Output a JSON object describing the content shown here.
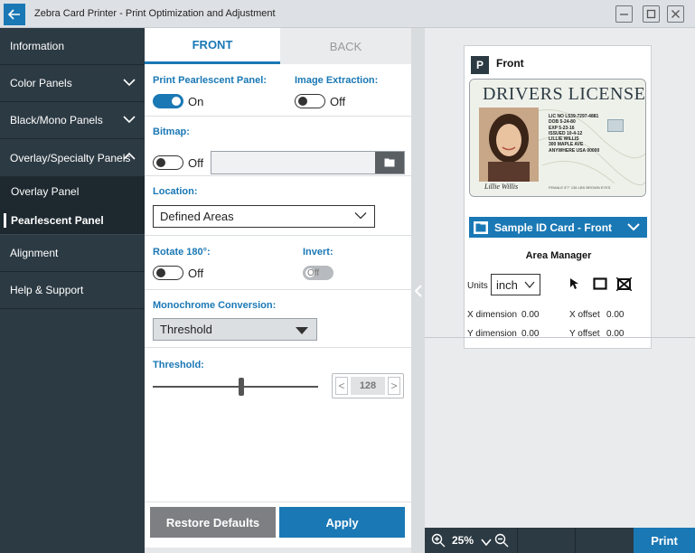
{
  "window": {
    "title": "Zebra Card Printer - Print Optimization and Adjustment"
  },
  "sidebar": {
    "items": [
      {
        "label": "Information"
      },
      {
        "label": "Color Panels"
      },
      {
        "label": "Black/Mono Panels"
      },
      {
        "label": "Overlay/Specialty Panels"
      },
      {
        "label": "Overlay Panel"
      },
      {
        "label": "Pearlescent Panel"
      },
      {
        "label": "Alignment"
      },
      {
        "label": "Help & Support"
      }
    ]
  },
  "tabs": {
    "front": "FRONT",
    "back": "BACK"
  },
  "settings": {
    "print_pearlescent": {
      "label": "Print Pearlescent Panel:",
      "state": "On"
    },
    "image_extraction": {
      "label": "Image Extraction:",
      "state": "Off"
    },
    "bitmap": {
      "label": "Bitmap:",
      "state": "Off",
      "value": ""
    },
    "location": {
      "label": "Location:",
      "value": "Defined Areas"
    },
    "rotate": {
      "label": "Rotate 180°:",
      "state": "Off"
    },
    "invert": {
      "label": "Invert:",
      "state": "Off"
    },
    "monochrome": {
      "label": "Monochrome Conversion:",
      "value": "Threshold"
    },
    "threshold": {
      "label": "Threshold:",
      "value": "128",
      "slider_fraction": 0.5
    }
  },
  "footer": {
    "restore_label": "Restore Defaults",
    "apply_label": "Apply"
  },
  "preview": {
    "side_badge": "P",
    "side_title": "Front",
    "license": {
      "title": "DRIVERS LICENSE",
      "lines": [
        "LIC NO L539-7297-4881",
        "DOB 5-24-80",
        "EXP 5-23-16",
        "ISSUED 10-4-12",
        "LILLIE WILLIS",
        "300 MAPLE AVE",
        "ANYWHERE USA 00000"
      ],
      "small": "FEMALE 5'7\" 135 LBS BROWN EYES",
      "signature": "Lillie Willis"
    },
    "card_select": "Sample ID Card - Front",
    "area_manager": "Area Manager",
    "units_label": "Units",
    "units_value": "inch",
    "x_dimension": {
      "label": "X dimension",
      "value": "0.00"
    },
    "y_dimension": {
      "label": "Y dimension",
      "value": "0.00"
    },
    "x_offset": {
      "label": "X offset",
      "value": "0.00"
    },
    "y_offset": {
      "label": "Y offset",
      "value": "0.00"
    }
  },
  "zoom": {
    "value": "25%"
  },
  "print_label": "Print",
  "colors": {
    "accent": "#1a78b5",
    "sidebar": "#2c3a43",
    "restore": "#7d7f82"
  },
  "icons": [
    "back-arrow-icon",
    "minimize-icon",
    "maximize-icon",
    "close-icon",
    "chevron-down-icon",
    "chevron-up-icon",
    "folder-icon",
    "collapse-icon",
    "cursor-icon",
    "rectangle-icon",
    "delete-area-icon",
    "zoom-in-icon",
    "zoom-out-icon"
  ]
}
